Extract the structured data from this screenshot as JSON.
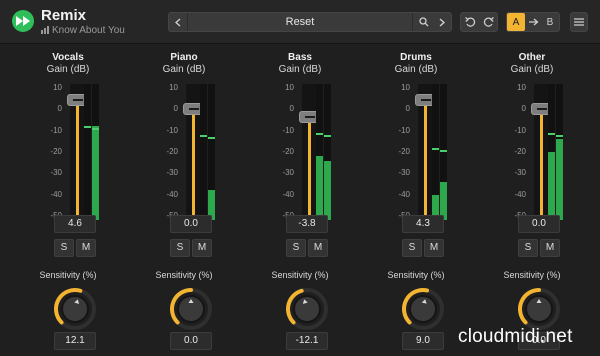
{
  "app": {
    "title": "Remix",
    "subtitle": "Know About You"
  },
  "preset": {
    "name": "Reset"
  },
  "ab": {
    "a": "A",
    "b": "B"
  },
  "scale_ticks": [
    "10",
    "0",
    "-10",
    "-20",
    "-30",
    "-40",
    "-50"
  ],
  "solo_label": "S",
  "mute_label": "M",
  "sensitivity_label": "Sensitivity (%)",
  "colors": {
    "accent": "#f2b431",
    "meter": "#2ea84c",
    "logo": "#2fbf5a",
    "background": "#1f1f1f"
  },
  "channels": [
    {
      "name": "Vocals",
      "unit": "Gain (dB)",
      "gain": "4.6",
      "sensitivity": "12.1",
      "meter_left_db": -50,
      "meter_right_db": -8,
      "peak_db": -8
    },
    {
      "name": "Piano",
      "unit": "Gain (dB)",
      "gain": "0.0",
      "sensitivity": "0.0",
      "meter_left_db": -50,
      "meter_right_db": -38,
      "peak_db": -12
    },
    {
      "name": "Bass",
      "unit": "Gain (dB)",
      "gain": "-3.8",
      "sensitivity": "-12.1",
      "meter_left_db": -22,
      "meter_right_db": -24,
      "peak_db": -11
    },
    {
      "name": "Drums",
      "unit": "Gain (dB)",
      "gain": "4.3",
      "sensitivity": "9.0",
      "meter_left_db": -40,
      "meter_right_db": -34,
      "peak_db": -18
    },
    {
      "name": "Other",
      "unit": "Gain (dB)",
      "gain": "0.0",
      "sensitivity": "0.0",
      "meter_left_db": -20,
      "meter_right_db": -14,
      "peak_db": -11
    }
  ],
  "watermark": "cloudmidi.net"
}
